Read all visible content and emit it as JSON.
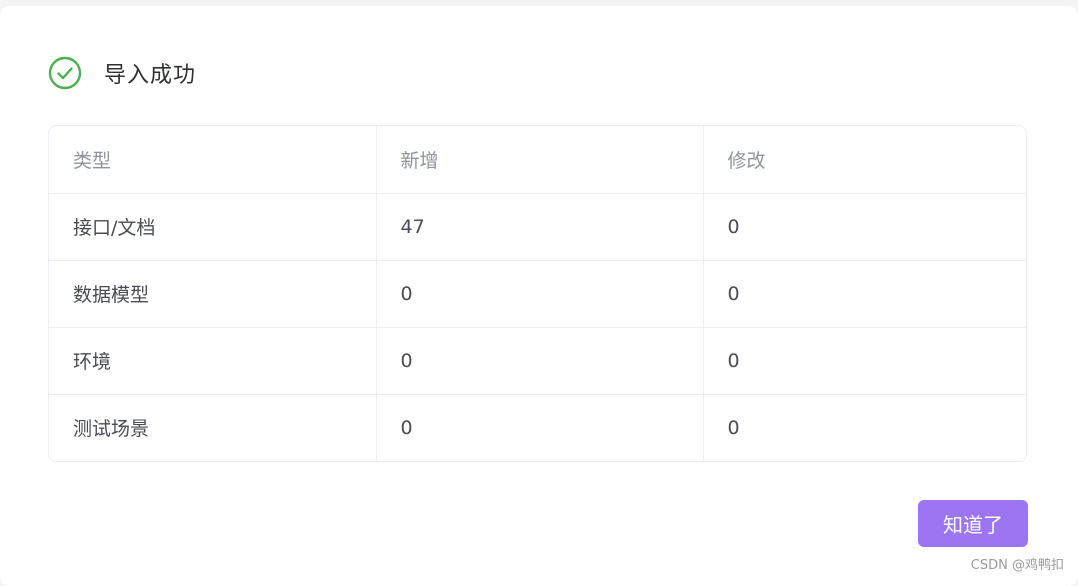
{
  "dialog": {
    "title": "导入成功",
    "icon": "check-circle-icon",
    "icon_color": "#4caf50"
  },
  "table": {
    "headers": [
      "类型",
      "新增",
      "修改"
    ],
    "rows": [
      [
        "接口/文档",
        "47",
        "0"
      ],
      [
        "数据模型",
        "0",
        "0"
      ],
      [
        "环境",
        "0",
        "0"
      ],
      [
        "测试场景",
        "0",
        "0"
      ]
    ]
  },
  "footer": {
    "confirm_label": "知道了",
    "button_color": "#9c76f2"
  },
  "watermark": "CSDN @鸡鸭扣"
}
